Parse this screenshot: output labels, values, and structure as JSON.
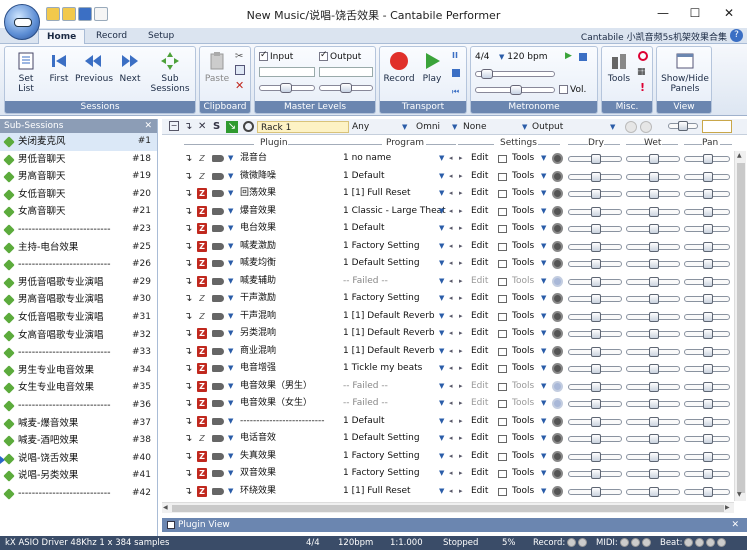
{
  "window": {
    "title": "New Music/说唱-饶舌效果 - Cantabile Performer",
    "minimize": "—",
    "maximize": "☐",
    "close": "✕"
  },
  "tabs": [
    {
      "label": "Home",
      "active": true
    },
    {
      "label": "Record",
      "active": false
    },
    {
      "label": "Setup",
      "active": false
    }
  ],
  "ribbon_right_text": "Cantabile 小凯音频5s机架效果合集",
  "ribbon": {
    "sessions": {
      "label": "Sessions",
      "set_list": "Set List",
      "first": "First",
      "previous": "Previous",
      "next": "Next",
      "sub_sessions": "Sub Sessions"
    },
    "clipboard": {
      "label": "Clipboard",
      "paste": "Paste"
    },
    "master_levels": {
      "label": "Master Levels",
      "input": "Input",
      "output": "Output"
    },
    "transport": {
      "label": "Transport",
      "record": "Record",
      "play": "Play"
    },
    "metronome": {
      "label": "Metronome",
      "time_sig": "4/4",
      "bpm": "120 bpm",
      "vol": "Vol."
    },
    "misc": {
      "label": "Misc.",
      "tools": "Tools"
    },
    "view": {
      "label": "View",
      "show_hide": "Show/Hide Panels"
    }
  },
  "sub_sessions": {
    "header": "Sub-Sessions",
    "close": "✕",
    "items": [
      {
        "label": "关闭麦克风",
        "num": "#1",
        "selected": true,
        "playing": false
      },
      {
        "label": "男低音聊天",
        "num": "#18",
        "selected": false,
        "playing": false
      },
      {
        "label": "男高音聊天",
        "num": "#19",
        "selected": false,
        "playing": false
      },
      {
        "label": "女低音聊天",
        "num": "#20",
        "selected": false,
        "playing": false
      },
      {
        "label": "女高音聊天",
        "num": "#21",
        "selected": false,
        "playing": false
      },
      {
        "label": "---------------------------",
        "num": "#23",
        "selected": false,
        "playing": false
      },
      {
        "label": "主持-电台效果",
        "num": "#25",
        "selected": false,
        "playing": false
      },
      {
        "label": "---------------------------",
        "num": "#26",
        "selected": false,
        "playing": false
      },
      {
        "label": "男低音唱歌专业演唱",
        "num": "#29",
        "selected": false,
        "playing": false
      },
      {
        "label": "男高音唱歌专业演唱",
        "num": "#30",
        "selected": false,
        "playing": false
      },
      {
        "label": "女低音唱歌专业演唱",
        "num": "#31",
        "selected": false,
        "playing": false
      },
      {
        "label": "女高音唱歌专业演唱",
        "num": "#32",
        "selected": false,
        "playing": false
      },
      {
        "label": "---------------------------",
        "num": "#33",
        "selected": false,
        "playing": false
      },
      {
        "label": "男生专业电音效果",
        "num": "#34",
        "selected": false,
        "playing": false
      },
      {
        "label": "女生专业电音效果",
        "num": "#35",
        "selected": false,
        "playing": false
      },
      {
        "label": "---------------------------",
        "num": "#36",
        "selected": false,
        "playing": false
      },
      {
        "label": "喊麦-爆音效果",
        "num": "#37",
        "selected": false,
        "playing": false
      },
      {
        "label": "喊麦-酒吧效果",
        "num": "#38",
        "selected": false,
        "playing": false
      },
      {
        "label": "说唱-饶舌效果",
        "num": "#40",
        "selected": false,
        "playing": true
      },
      {
        "label": "说唱-另类效果",
        "num": "#41",
        "selected": false,
        "playing": false
      },
      {
        "label": "---------------------------",
        "num": "#42",
        "selected": false,
        "playing": false
      }
    ]
  },
  "rack_toolbar": {
    "rack_name": "Rack 1",
    "channel": "Any",
    "omni": "Omni",
    "none": "None",
    "output": "Output"
  },
  "columns": {
    "plugin": "Plugin",
    "program": "Program",
    "settings": "Settings",
    "dry": "Dry",
    "wet": "Wet",
    "pan": "Pan"
  },
  "plugins": [
    {
      "name": "混音台",
      "program": "1 no name",
      "z_on": false,
      "failed": false,
      "dry": 0.5,
      "wet": 0.5
    },
    {
      "name": "微微降噪",
      "program": "1 Default",
      "z_on": false,
      "failed": false,
      "dry": 0.5,
      "wet": 0.5
    },
    {
      "name": "回荡效果",
      "program": "1 [1] Full Reset",
      "z_on": true,
      "failed": false,
      "dry": 0.5,
      "wet": 0.5
    },
    {
      "name": "爆音效果",
      "program": "1 Classic - Large Theat",
      "z_on": true,
      "failed": false,
      "dry": 0.5,
      "wet": 0.5
    },
    {
      "name": "电台效果",
      "program": "1 Default",
      "z_on": true,
      "failed": false,
      "dry": 0.5,
      "wet": 0.5
    },
    {
      "name": "喊麦激励",
      "program": "1 Factory Setting",
      "z_on": true,
      "failed": false,
      "dry": 0.5,
      "wet": 0.5
    },
    {
      "name": "喊麦均衡",
      "program": "1 Default Setting",
      "z_on": true,
      "failed": false,
      "dry": 0.5,
      "wet": 0.5
    },
    {
      "name": "喊麦辅助",
      "program": "-- Failed --",
      "z_on": true,
      "failed": true,
      "dry": 0.5,
      "wet": 0.5
    },
    {
      "name": "干声激励",
      "program": "1 Factory Setting",
      "z_on": false,
      "failed": false,
      "dry": 0.5,
      "wet": 0.5
    },
    {
      "name": "干声混响",
      "program": "1 [1] Default Reverb",
      "z_on": false,
      "failed": false,
      "dry": 0.5,
      "wet": 0.5
    },
    {
      "name": "另类混响",
      "program": "1 [1] Default Reverb",
      "z_on": true,
      "failed": false,
      "dry": 0.5,
      "wet": 0.5
    },
    {
      "name": "商业混响",
      "program": "1 [1] Default Reverb",
      "z_on": true,
      "failed": false,
      "dry": 0.5,
      "wet": 0.5
    },
    {
      "name": "电音增强",
      "program": "1 Tickle my beats",
      "z_on": true,
      "failed": false,
      "dry": 0.5,
      "wet": 0.5
    },
    {
      "name": "电音效果（男生）",
      "program": "-- Failed --",
      "z_on": true,
      "failed": true,
      "dry": 0.5,
      "wet": 0.5
    },
    {
      "name": "电音效果（女生）",
      "program": "-- Failed --",
      "z_on": true,
      "failed": true,
      "dry": 0.5,
      "wet": 0.5
    },
    {
      "name": "--------------------------",
      "program": "1 Default",
      "z_on": true,
      "failed": false,
      "dry": 0.5,
      "wet": 0.5
    },
    {
      "name": "电话音效",
      "program": "1 Default Setting",
      "z_on": false,
      "failed": false,
      "dry": 0.5,
      "wet": 0.5
    },
    {
      "name": "失真效果",
      "program": "1 Factory Setting",
      "z_on": true,
      "failed": false,
      "dry": 0.5,
      "wet": 0.5
    },
    {
      "name": "双音效果",
      "program": "1 Factory Setting",
      "z_on": true,
      "failed": false,
      "dry": 0.5,
      "wet": 0.5
    },
    {
      "name": "环绕效果",
      "program": "1 [1] Full Reset",
      "z_on": true,
      "failed": false,
      "dry": 0.5,
      "wet": 0.5
    }
  ],
  "row_labels": {
    "edit": "Edit",
    "tools": "Tools"
  },
  "plugin_view": "Plugin View",
  "status": {
    "driver": "kX ASIO Driver 48Khz 1 x 384 samples",
    "time_sig": "4/4",
    "bpm": "120bpm",
    "position": "1:1.000",
    "state": "Stopped",
    "cpu": "5%",
    "record": "Record:",
    "midi": "MIDI:",
    "beat": "Beat:"
  }
}
